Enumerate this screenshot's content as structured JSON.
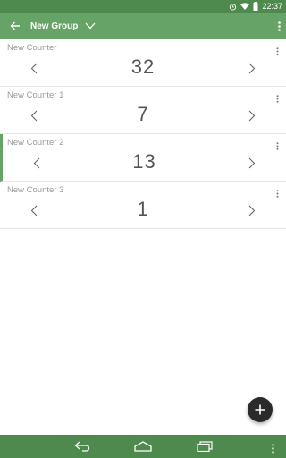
{
  "status_bar": {
    "time": "22:37"
  },
  "app_bar": {
    "title": "New Group"
  },
  "counters": [
    {
      "name": "New Counter",
      "value": "32"
    },
    {
      "name": "New Counter 1",
      "value": "7"
    },
    {
      "name": "New Counter 2",
      "value": "13"
    },
    {
      "name": "New Counter 3",
      "value": "1"
    }
  ],
  "colors": {
    "toolbar": "#66a366",
    "status_bar": "#4e8a4e",
    "fab": "#2a2a2a"
  },
  "icons": {
    "back": "arrow-left-icon",
    "dropdown": "chevron-down-icon",
    "overflow": "more-vert-icon",
    "decrement": "chevron-left-icon",
    "increment": "chevron-right-icon",
    "fab": "plus-icon"
  }
}
